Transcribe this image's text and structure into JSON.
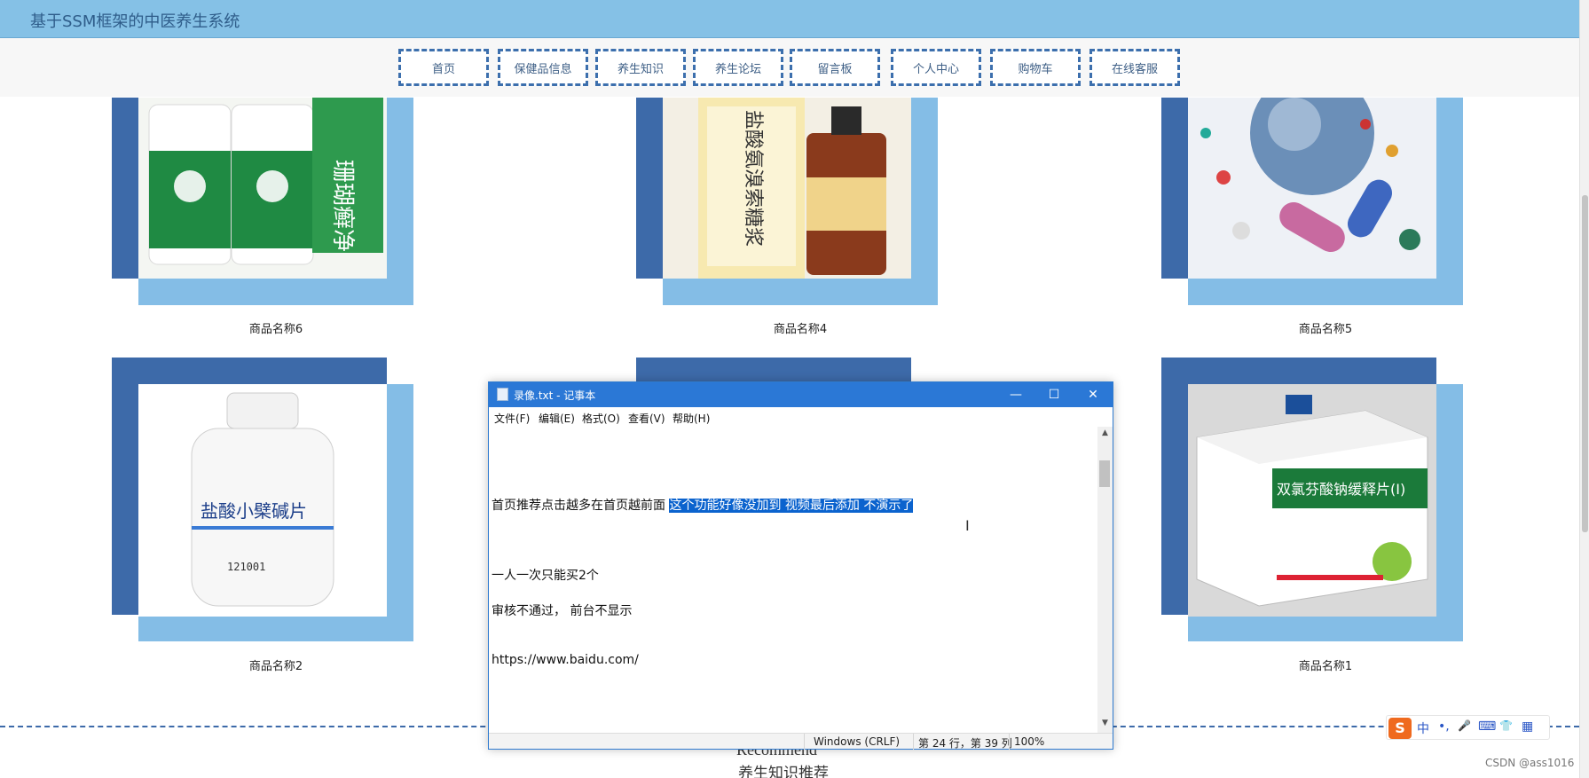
{
  "header": {
    "site_title": "基于SSM框架的中医养生系统"
  },
  "nav": {
    "items": [
      {
        "label": "首页"
      },
      {
        "label": "保健品信息"
      },
      {
        "label": "养生知识"
      },
      {
        "label": "养生论坛"
      },
      {
        "label": "留言板"
      },
      {
        "label": "个人中心"
      },
      {
        "label": "购物车"
      },
      {
        "label": "在线客服"
      }
    ]
  },
  "products": [
    {
      "name": "商品名称6",
      "image": "green-cream-bottles",
      "image_text": "珊瑚癣净"
    },
    {
      "name": "商品名称4",
      "image": "syrup-bottle",
      "image_text": "盐酸氨溴索糖浆"
    },
    {
      "name": "商品名称5",
      "image": "pills-globe"
    },
    {
      "name": "商品名称2",
      "image": "white-pill-bottle",
      "image_text": "盐酸小檗碱片"
    },
    {
      "name": "",
      "image": "hidden-behind-window"
    },
    {
      "name": "商品名称1",
      "image": "medicine-box",
      "image_text": "双氯芬酸钠缓释片(I)"
    }
  ],
  "recommend": {
    "title_en": "Recommend",
    "title_cn": "养生知识推荐"
  },
  "notepad": {
    "title": "录像.txt - 记事本",
    "menu": [
      "文件(F)",
      "编辑(E)",
      "格式(O)",
      "查看(V)",
      "帮助(H)"
    ],
    "lines": {
      "line1_plain": "首页推荐点击越多在首页越前面",
      "line1_selected": "这个功能好像没加到 视频最后添加  不演示了",
      "line2": "一人一次只能买2个",
      "line3": "审核不通过， 前台不显示",
      "line4": "https://www.baidu.com/"
    },
    "status": {
      "encoding": "Windows (CRLF)",
      "position": "第 24 行，第 39 列",
      "zoom": "100%"
    },
    "buttons": {
      "minimize": "—",
      "maximize": "☐",
      "close": "✕"
    }
  },
  "ime": {
    "mode": "中",
    "punct": "•,",
    "mic": "🎤",
    "keyboard": "⌨",
    "skin": "👕",
    "grid": "▦",
    "logo": "S"
  },
  "watermark": "CSDN @ass1016",
  "colors": {
    "header_bg": "#85c1e6",
    "card_back": "#3d6aa9",
    "card_front": "#84bde6",
    "notepad_title": "#2b78d6"
  }
}
